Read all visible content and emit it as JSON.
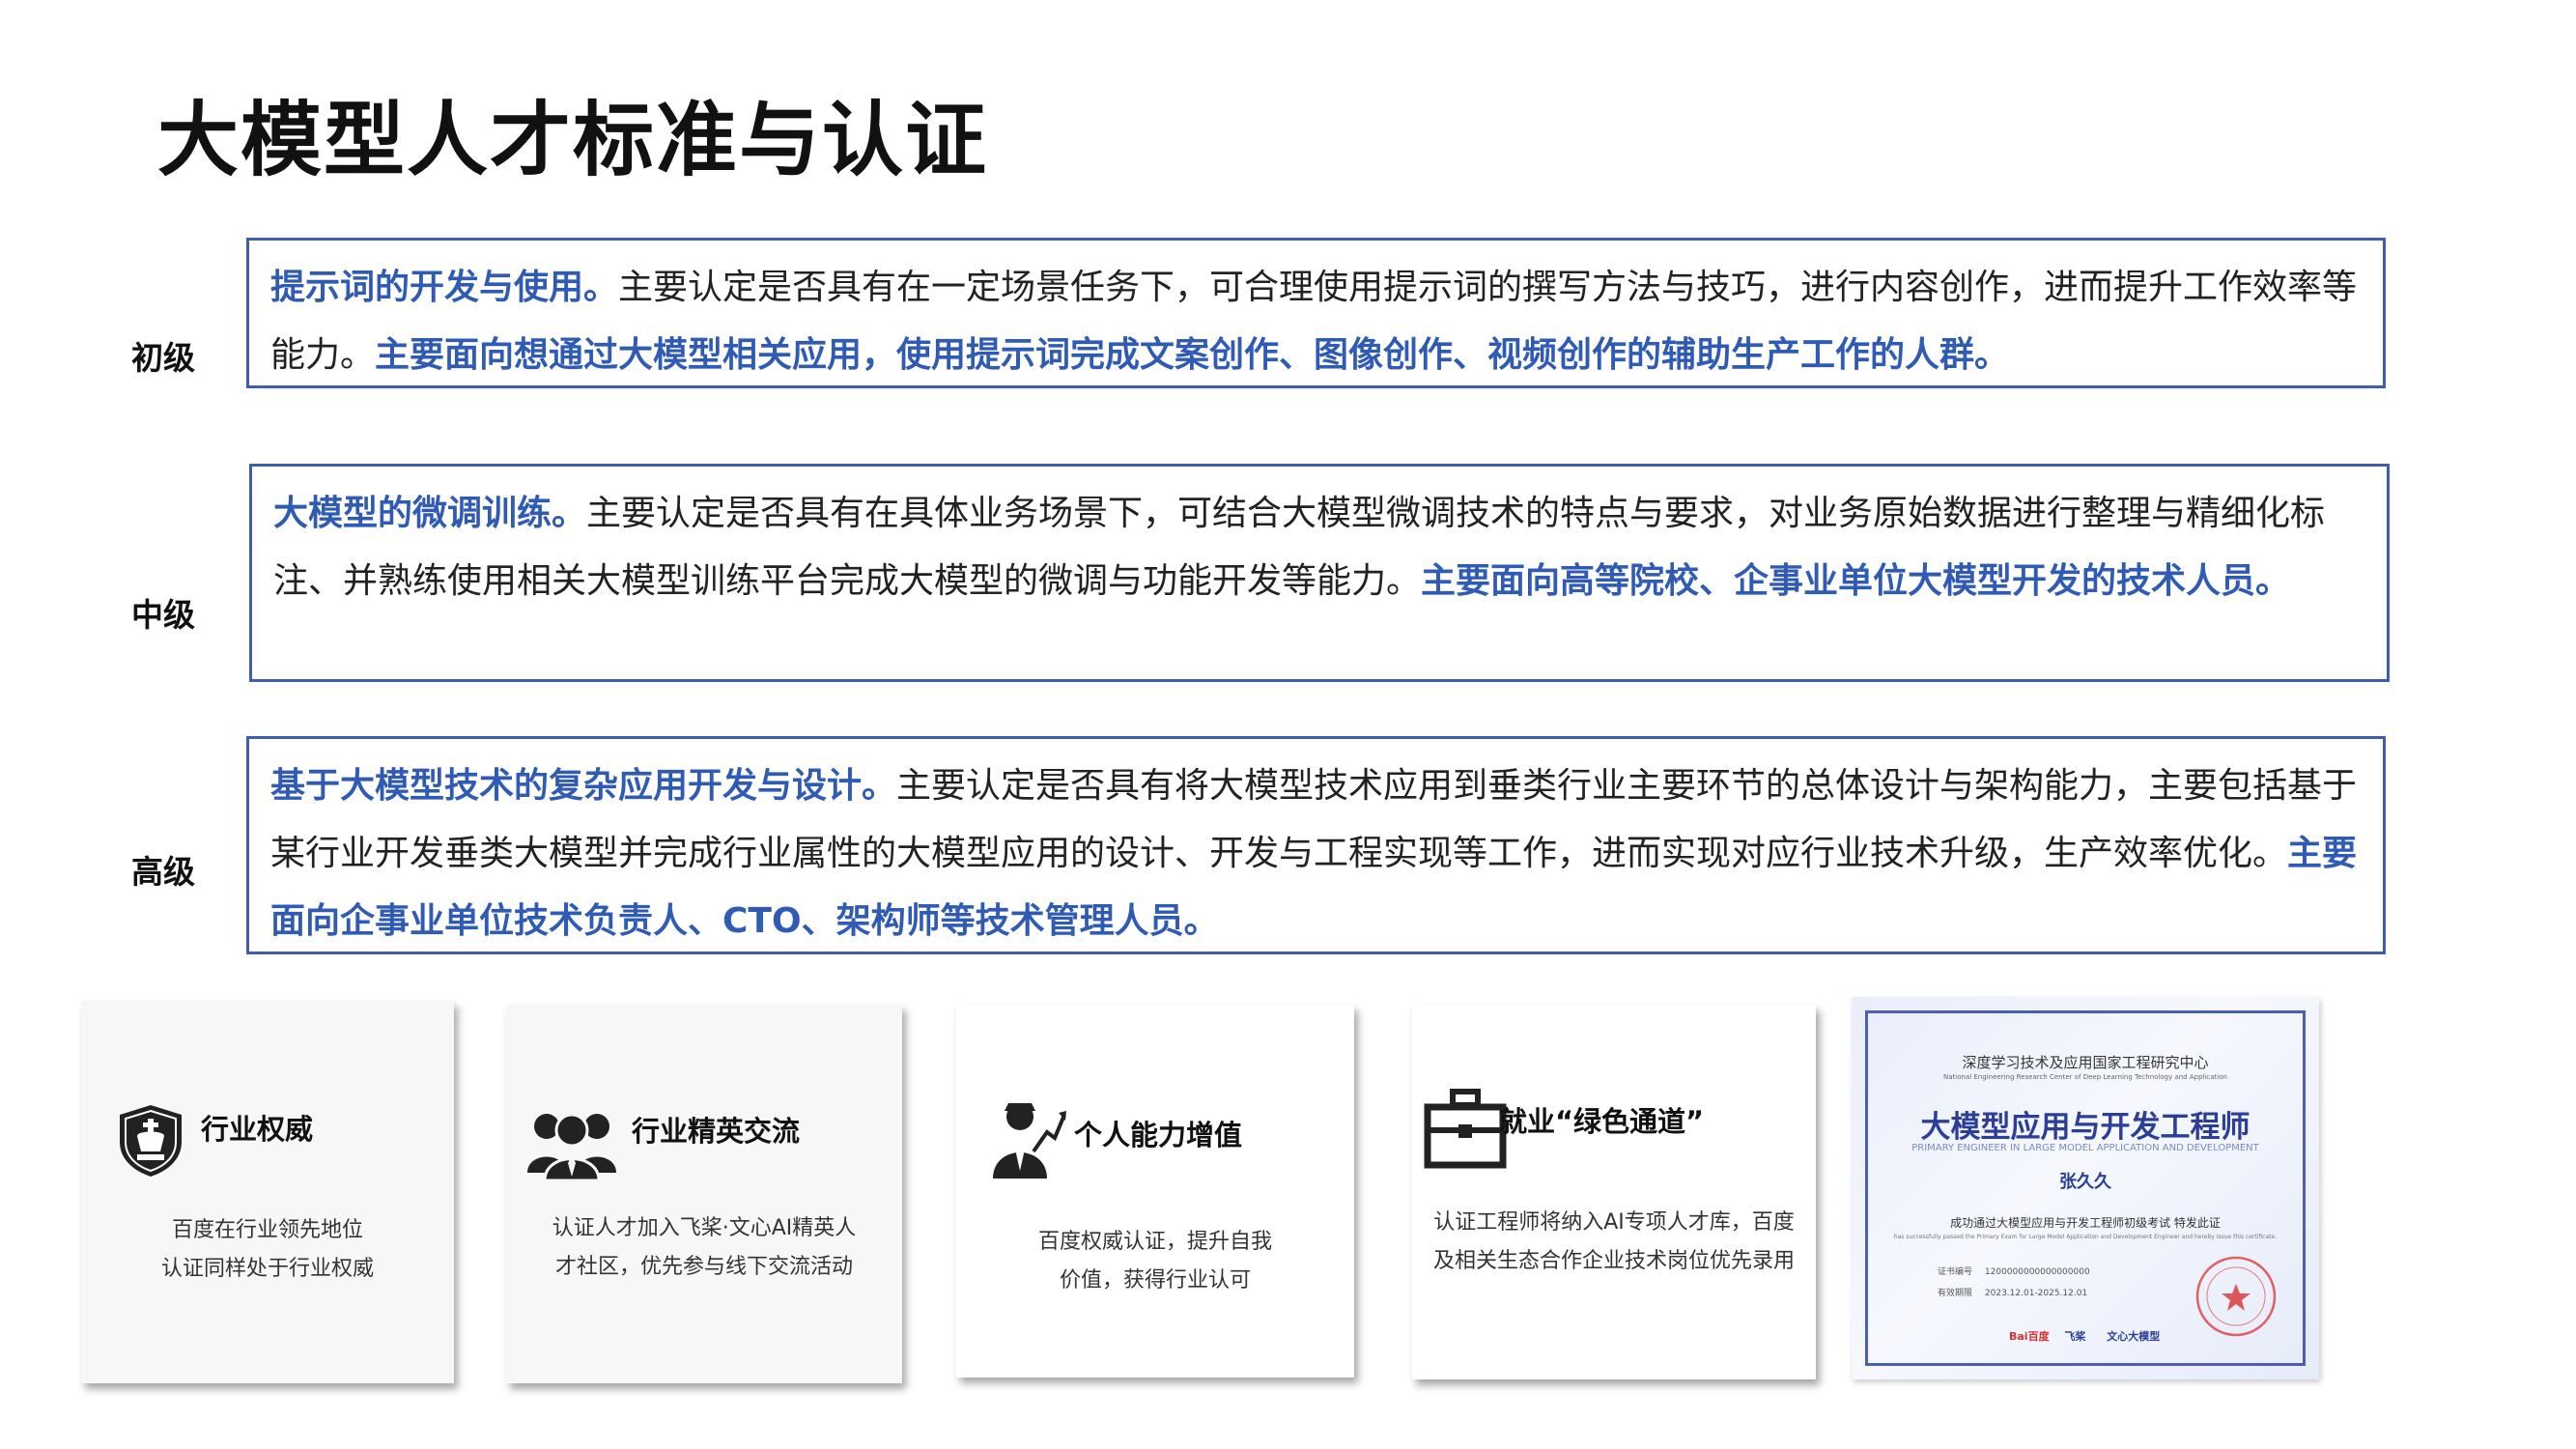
{
  "title": "大模型人才标准与认证",
  "levels": [
    {
      "label": "初级",
      "highlight": "提示词的开发与使用。",
      "body": "主要认定是否具有在一定场景任务下，可合理使用提示词的撰写方法与技巧，进行内容创作，进而提升工作效率等能力。",
      "audience": "主要面向想通过大模型相关应用，使用提示词完成文案创作、图像创作、视频创作的辅助生产工作的人群。"
    },
    {
      "label": "中级",
      "highlight": "大模型的微调训练。",
      "body": "主要认定是否具有在具体业务场景下，可结合大模型微调技术的特点与要求，对业务原始数据进行整理与精细化标注、并熟练使用相关大模型训练平台完成大模型的微调与功能开发等能力。",
      "audience": "主要面向高等院校、企事业单位大模型开发的技术人员。"
    },
    {
      "label": "高级",
      "highlight": "基于大模型技术的复杂应用开发与设计。",
      "body": "主要认定是否具有将大模型技术应用到垂类行业主要环节的总体设计与架构能力，主要包括基于某行业开发垂类大模型并完成行业属性的大模型应用的设计、开发与工程实现等工作，进而实现对应行业技术升级，生产效率优化。",
      "audience": "主要面向企事业单位技术负责人、CTO、架构师等技术管理人员。"
    }
  ],
  "cards": [
    {
      "icon": "chess-king-shield-icon",
      "head": "行业权威",
      "line1": "百度在行业领先地位",
      "line2": "认证同样处于行业权威"
    },
    {
      "icon": "people-group-icon",
      "head": "行业精英交流",
      "line1": "认证人才加入飞桨·文心AI精英人",
      "line2": "才社区，优先参与线下交流活动"
    },
    {
      "icon": "person-growth-icon",
      "head": "个人能力增值",
      "line1": "百度权威认证，提升自我",
      "line2": "价值，获得行业认可"
    },
    {
      "icon": "briefcase-icon",
      "head": "就业“绿色通道”",
      "line1": "认证工程师将纳入AI专项人才库，百度",
      "line2": "及相关生态合作企业技术岗位优先录用"
    }
  ],
  "certificate": {
    "org": "深度学习技术及应用国家工程研究中心",
    "org_en": "National Engineering Research Center of Deep Learning Technology and Application",
    "title": "大模型应用与开发工程师",
    "title_en": "PRIMARY ENGINEER IN LARGE MODEL APPLICATION AND DEVELOPMENT",
    "name": "张久久",
    "statement": "成功通过大模型应用与开发工程师初级考试 特发此证",
    "statement_en": "has successfully passed the Primary Exam for Large Model Application and Development Engineer and hereby issue this certificate.",
    "cert_no_label": "证书编号",
    "cert_no": "1200000000000000000",
    "validity_label": "有效期限",
    "validity": "2023.12.01-2025.12.01",
    "logos": [
      "Bai百度",
      "飞桨",
      "文心大模型"
    ],
    "colors": {
      "frame": "#4a5fb5",
      "title": "#2c3f98",
      "seal": "#d9302f"
    }
  }
}
